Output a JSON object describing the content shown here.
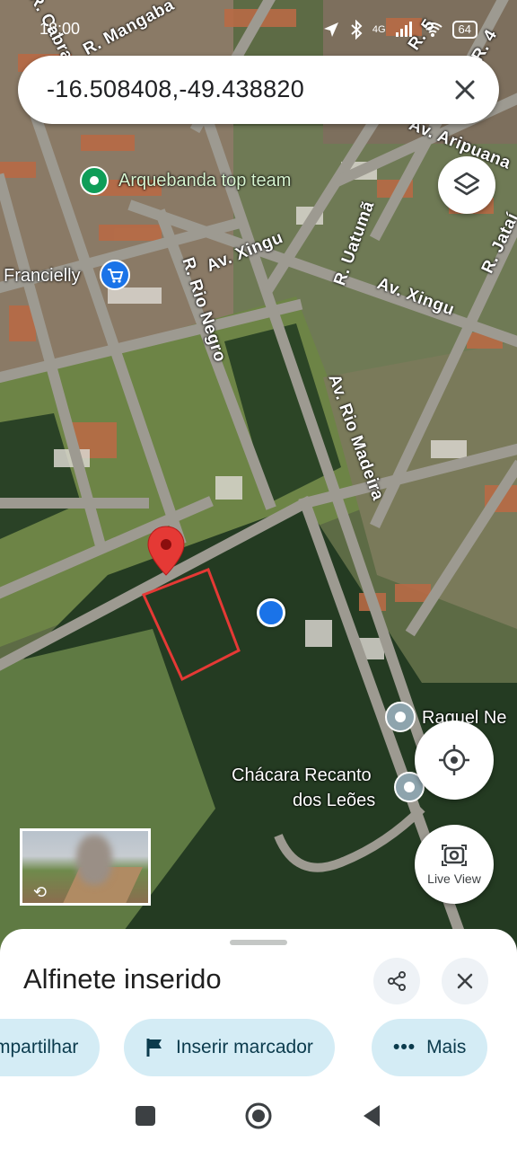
{
  "status_bar": {
    "time": "18:00",
    "signal": "4G",
    "battery": "64",
    "icons": [
      "location-icon",
      "bluetooth-icon",
      "signal-icon",
      "wifi-icon",
      "battery-icon"
    ]
  },
  "search": {
    "coordinates": "-16.508408,-49.438820",
    "close_icon": "close-icon"
  },
  "map": {
    "streets": [
      "R. Mangaba",
      "R. Cabral",
      "R. 5",
      "R. 4",
      "Av. Aripuana",
      "R. Jataí",
      "Av. Xingu",
      "Av. Xingu",
      "R. Uatumã",
      "R. Rio Negro",
      "Av. Rio Madeira"
    ],
    "places": [
      {
        "name": "Arquebanda top team",
        "icon": "place-pin-icon"
      },
      {
        "name": "Francielly",
        "icon": "shopping-cart-icon"
      },
      {
        "name": "Raquel Ne",
        "icon": "place-pin-icon"
      },
      {
        "name": "Chácara Recanto",
        "name2": "dos Leões",
        "icon": "place-pin-icon"
      }
    ],
    "dropped_pin_icon": "red-pin-icon",
    "accent_red": "#e53935",
    "user_dot_color": "#1a73e8"
  },
  "controls": {
    "layers_icon": "layers-icon",
    "locate_icon": "my-location-icon",
    "live_view_label": "Live View"
  },
  "sheet": {
    "title": "Alfinete inserido",
    "share_icon": "share-icon",
    "close_icon": "close-icon",
    "chips": [
      {
        "label": "mpartilhar",
        "icon": "share-icon"
      },
      {
        "label": "Inserir marcador",
        "icon": "flag-icon"
      },
      {
        "label": "Mais",
        "icon": "more-icon"
      }
    ]
  },
  "nav": {
    "recents": "recents-icon",
    "home": "home-icon",
    "back": "back-icon"
  }
}
